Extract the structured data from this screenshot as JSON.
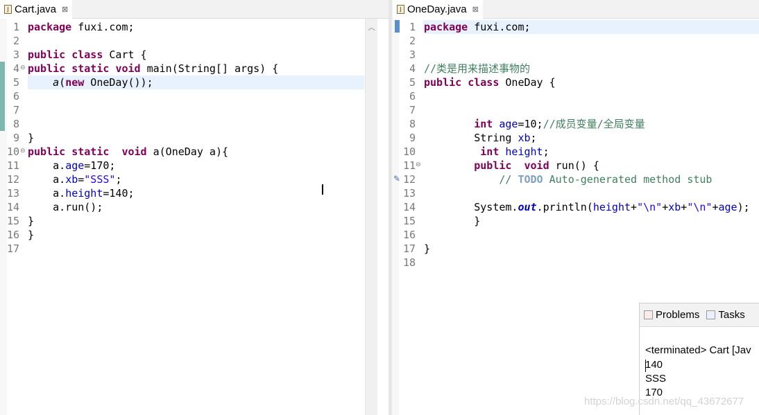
{
  "left_editor": {
    "tab": {
      "title": "Cart.java",
      "close": "⊠"
    },
    "line_numbers": [
      "1",
      "2",
      "3",
      "4",
      "5",
      "6",
      "7",
      "8",
      "9",
      "10",
      "11",
      "12",
      "13",
      "14",
      "15",
      "16",
      "17"
    ],
    "lines": [
      [
        [
          "kw",
          "package"
        ],
        [
          "p",
          " fuxi.com;"
        ]
      ],
      [],
      [
        [
          "kw",
          "public"
        ],
        [
          "p",
          " "
        ],
        [
          "kw",
          "class"
        ],
        [
          "p",
          " Cart {"
        ]
      ],
      [
        [
          "kw",
          "public"
        ],
        [
          "p",
          " "
        ],
        [
          "kw",
          "static"
        ],
        [
          "p",
          " "
        ],
        [
          "kw",
          "void"
        ],
        [
          "p",
          " main(String[] "
        ],
        [
          "arg",
          "args"
        ],
        [
          "p",
          ") {"
        ]
      ],
      [
        [
          "p",
          "    "
        ],
        [
          "sm",
          "a"
        ],
        [
          "p",
          "("
        ],
        [
          "kw",
          "new"
        ],
        [
          "p",
          " OneDay());"
        ]
      ],
      [],
      [],
      [],
      [
        [
          "p",
          "}"
        ]
      ],
      [
        [
          "kw",
          "public"
        ],
        [
          "p",
          " "
        ],
        [
          "kw",
          "static"
        ],
        [
          "p",
          "  "
        ],
        [
          "kw",
          "void"
        ],
        [
          "p",
          " a(OneDay "
        ],
        [
          "arg",
          "a"
        ],
        [
          "p",
          "){"
        ]
      ],
      [
        [
          "p",
          "    "
        ],
        [
          "arg",
          "a"
        ],
        [
          "p",
          "."
        ],
        [
          "fld",
          "age"
        ],
        [
          "p",
          "=170;"
        ]
      ],
      [
        [
          "p",
          "    "
        ],
        [
          "arg",
          "a"
        ],
        [
          "p",
          "."
        ],
        [
          "fld",
          "xb"
        ],
        [
          "p",
          "="
        ],
        [
          "str",
          "\"SSS\""
        ],
        [
          "p",
          ";"
        ]
      ],
      [
        [
          "p",
          "    "
        ],
        [
          "arg",
          "a"
        ],
        [
          "p",
          "."
        ],
        [
          "fld",
          "height"
        ],
        [
          "p",
          "=140;"
        ]
      ],
      [
        [
          "p",
          "    "
        ],
        [
          "arg",
          "a"
        ],
        [
          "p",
          ".run();"
        ]
      ],
      [
        [
          "p",
          "}"
        ]
      ],
      [
        [
          "p",
          "}"
        ]
      ],
      []
    ]
  },
  "right_editor": {
    "tab": {
      "title": "OneDay.java",
      "close": "⊠"
    },
    "line_numbers": [
      "1",
      "2",
      "3",
      "4",
      "5",
      "6",
      "7",
      "8",
      "9",
      "10",
      "11",
      "12",
      "13",
      "14",
      "15",
      "16",
      "17",
      "18"
    ],
    "lines": [
      [
        [
          "kw",
          "package"
        ],
        [
          "p",
          " fuxi.com;"
        ]
      ],
      [],
      [],
      [
        [
          "cmt",
          "//类是用来描述事物的"
        ]
      ],
      [
        [
          "kw",
          "public"
        ],
        [
          "p",
          " "
        ],
        [
          "kw",
          "class"
        ],
        [
          "p",
          " OneDay {"
        ]
      ],
      [],
      [],
      [
        [
          "p",
          "        "
        ],
        [
          "kw",
          "int"
        ],
        [
          "p",
          " "
        ],
        [
          "fld",
          "age"
        ],
        [
          "p",
          "=10;"
        ],
        [
          "cmt",
          "//成员变量/全局变量"
        ]
      ],
      [
        [
          "p",
          "        String "
        ],
        [
          "fld",
          "xb"
        ],
        [
          "p",
          ";"
        ]
      ],
      [
        [
          "p",
          "         "
        ],
        [
          "kw",
          "int"
        ],
        [
          "p",
          " "
        ],
        [
          "fld",
          "height"
        ],
        [
          "p",
          ";"
        ]
      ],
      [
        [
          "p",
          "        "
        ],
        [
          "kw",
          "public"
        ],
        [
          "p",
          "  "
        ],
        [
          "kw",
          "void"
        ],
        [
          "p",
          " run() {"
        ]
      ],
      [
        [
          "p",
          "            "
        ],
        [
          "cmt",
          "// "
        ],
        [
          "todo",
          "TODO"
        ],
        [
          "cmt",
          " Auto-generated method stub"
        ]
      ],
      [],
      [
        [
          "p",
          "        System."
        ],
        [
          "sf",
          "out"
        ],
        [
          "p",
          ".println("
        ],
        [
          "fld",
          "height"
        ],
        [
          "p",
          "+"
        ],
        [
          "str",
          "\"\\n\""
        ],
        [
          "p",
          "+"
        ],
        [
          "fld",
          "xb"
        ],
        [
          "p",
          "+"
        ],
        [
          "str",
          "\"\\n\""
        ],
        [
          "p",
          "+"
        ],
        [
          "fld",
          "age"
        ],
        [
          "p",
          ");"
        ]
      ],
      [
        [
          "p",
          "        }"
        ]
      ],
      [],
      [
        [
          "p",
          "}"
        ]
      ],
      []
    ]
  },
  "console": {
    "tabs": [
      {
        "label": "Problems",
        "icon": "problems-icon"
      },
      {
        "label": "Tasks",
        "icon": "tasks-icon"
      }
    ],
    "status": "<terminated> Cart [Jav",
    "output": [
      "140",
      "SSS",
      "170"
    ]
  },
  "watermark": "https://blog.csdn.net/qq_43672677",
  "colors": {
    "keyword": "#7f0055",
    "field": "#0000c0",
    "string": "#2a00ff",
    "comment": "#3f7f5f",
    "current_line": "#e8f2fe",
    "change_bar": "#7fb8b0"
  }
}
